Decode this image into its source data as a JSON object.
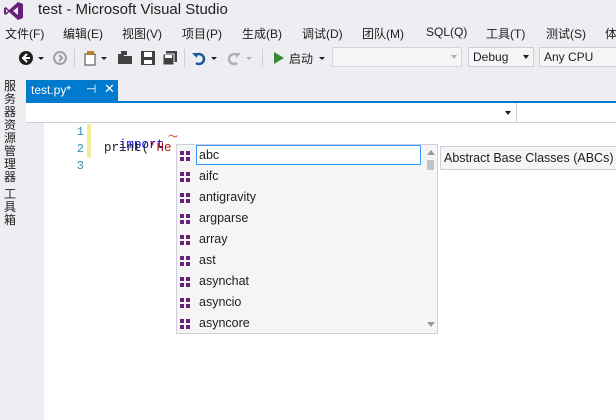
{
  "window": {
    "title": "test - Microsoft Visual Studio"
  },
  "menu": [
    "文件(F)",
    "编辑(E)",
    "视图(V)",
    "项目(P)",
    "生成(B)",
    "调试(D)",
    "团队(M)",
    "SQL(Q)",
    "工具(T)",
    "测试(S)",
    "体"
  ],
  "toolbar": {
    "start_label": "启动",
    "target_combo": "",
    "config_combo": "Debug",
    "platform_combo": "Any CPU"
  },
  "side_panel": {
    "server_explorer": "服务器资源管理器",
    "toolbox": "工具箱"
  },
  "tab": {
    "label": "test.py*",
    "pin": "⊣",
    "close": "✕"
  },
  "editor": {
    "line_numbers": [
      "1",
      "2",
      "3"
    ],
    "line1": {
      "keyword": "import"
    },
    "line2": {
      "func": "print(",
      "string": "'He"
    }
  },
  "completion": {
    "items": [
      "abc",
      "aifc",
      "antigravity",
      "argparse",
      "array",
      "ast",
      "asynchat",
      "asyncio",
      "asyncore"
    ],
    "selected": "abc",
    "tooltip": "Abstract Base Classes (ABCs)"
  },
  "colors": {
    "accent": "#007acc",
    "keyword": "#0000ff",
    "string": "#a31515",
    "line_number": "#2b91af",
    "module_icon": "#68217a"
  }
}
